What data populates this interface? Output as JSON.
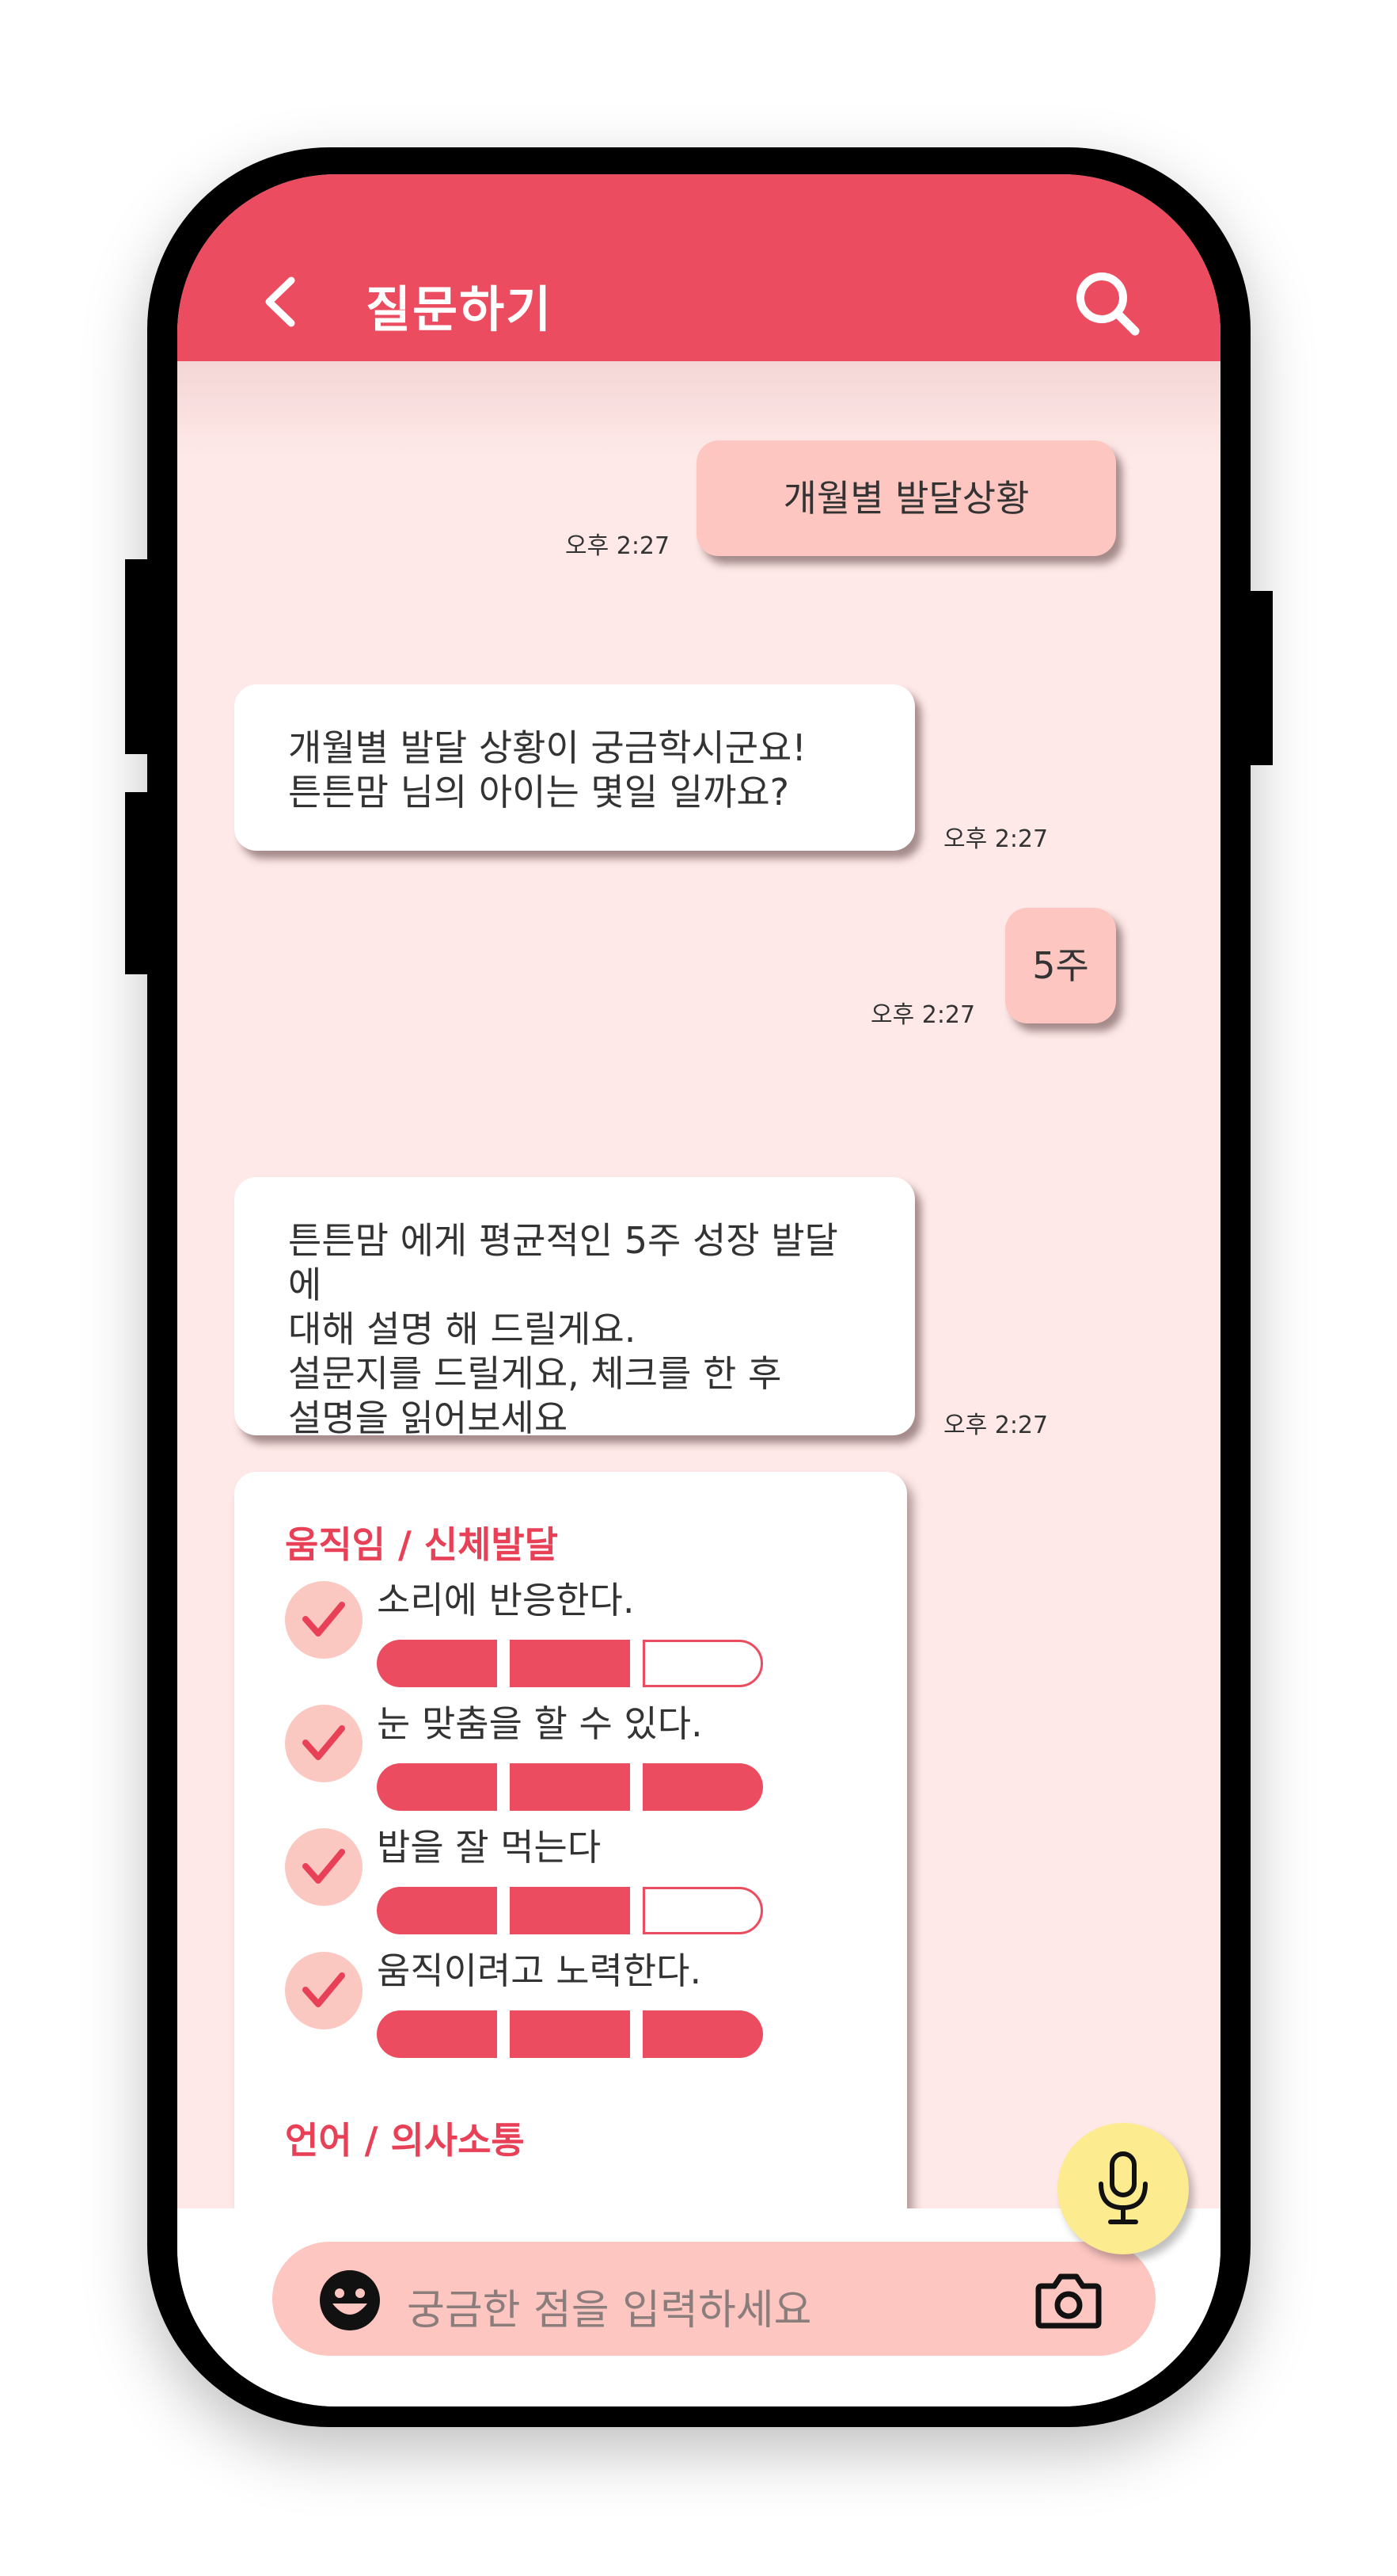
{
  "header": {
    "title": "질문하기"
  },
  "messages": [
    {
      "from": "me",
      "text": "개월별 발달상황",
      "time": "오후 2:27"
    },
    {
      "from": "bot",
      "lines": [
        "개월별 발달 상황이 궁금학시군요!",
        "튼튼맘 님의 아이는 몇일 일까요?"
      ],
      "time": "오후 2:27"
    },
    {
      "from": "me",
      "text": "5주",
      "time": "오후 2:27"
    },
    {
      "from": "bot",
      "lines": [
        "튼튼맘 에게 평균적인 5주 성장 발달에",
        "대해 설명 해 드릴게요.",
        "설문지를 드릴게요, 체크를 한 후",
        "설명을 읽어보세요"
      ],
      "time": "오후 2:27"
    }
  ],
  "checklist": {
    "sections": [
      {
        "title": "움직임 / 신체발달",
        "items": [
          {
            "label": "소리에 반응한다.",
            "checked": true,
            "level": 2,
            "max": 3
          },
          {
            "label": "눈 맞춤을 할 수 있다.",
            "checked": true,
            "level": 3,
            "max": 3
          },
          {
            "label": "밥을 잘 먹는다",
            "checked": true,
            "level": 2,
            "max": 3
          },
          {
            "label": "움직이려고 노력한다.",
            "checked": true,
            "level": 3,
            "max": 3
          }
        ]
      },
      {
        "title": "언어 / 의사소통",
        "items": []
      }
    ]
  },
  "input": {
    "placeholder": "궁금한 점을 입력하세요"
  },
  "icons": {
    "back": "chevron-left-icon",
    "search": "search-icon",
    "emoji": "smiley-icon",
    "camera": "camera-icon",
    "mic": "microphone-icon",
    "check": "checkmark-icon"
  },
  "colors": {
    "brand": "#ec4c5f",
    "bubble_me": "#fec6c1",
    "chat_bg": "#fee9e8",
    "mic_bg": "#fceb8f"
  }
}
